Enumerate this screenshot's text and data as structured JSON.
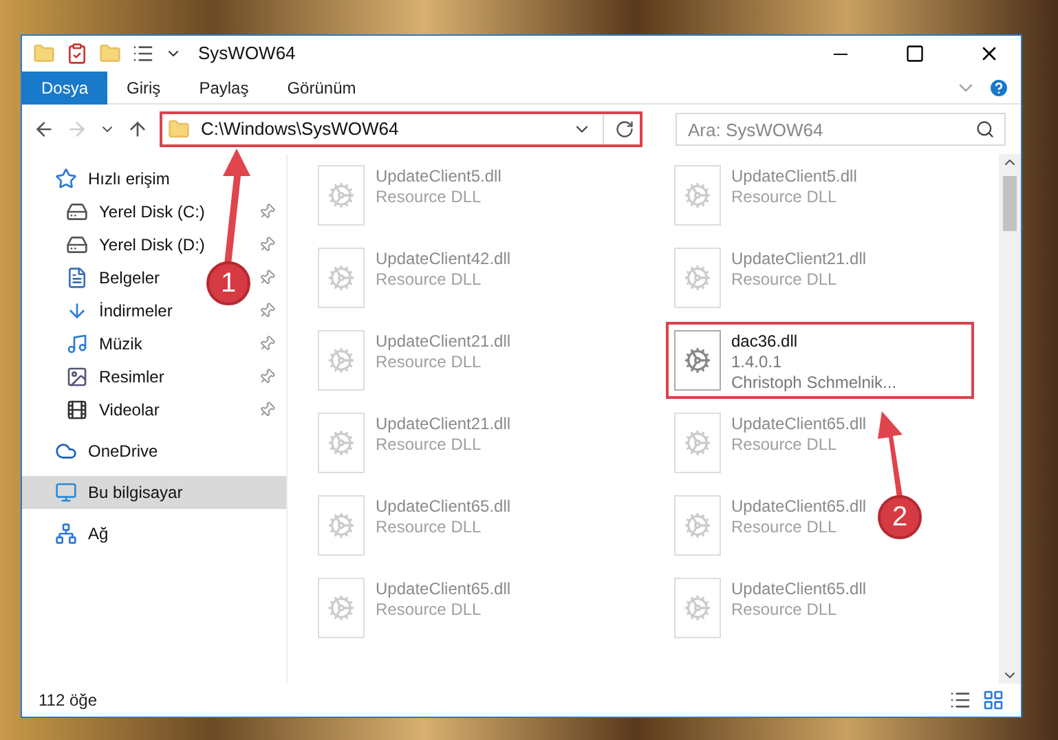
{
  "window": {
    "title": "SysWOW64"
  },
  "ribbon_tabs": [
    {
      "label": "Dosya",
      "selected": true
    },
    {
      "label": "Giriş",
      "selected": false
    },
    {
      "label": "Paylaş",
      "selected": false
    },
    {
      "label": "Görünüm",
      "selected": false
    }
  ],
  "address_bar": {
    "path": "C:\\Windows\\SysWOW64",
    "highlighted": true
  },
  "search": {
    "placeholder": "Ara: SysWOW64"
  },
  "sidebar": {
    "items": [
      {
        "label": "Hızlı erişim",
        "kind": "star",
        "selected": false,
        "children": [
          {
            "label": "Yerel Disk (C:)",
            "kind": "drive",
            "pinned": true
          },
          {
            "label": "Yerel Disk (D:)",
            "kind": "drive",
            "pinned": true
          },
          {
            "label": "Belgeler",
            "kind": "document",
            "pinned": true
          },
          {
            "label": "İndirmeler",
            "kind": "download",
            "pinned": true
          },
          {
            "label": "Müzik",
            "kind": "music",
            "pinned": true
          },
          {
            "label": "Resimler",
            "kind": "image",
            "pinned": true
          },
          {
            "label": "Videolar",
            "kind": "film",
            "pinned": true
          }
        ]
      },
      {
        "label": "OneDrive",
        "kind": "cloud",
        "selected": false
      },
      {
        "label": "Bu bilgisayar",
        "kind": "computer",
        "selected": true
      },
      {
        "label": "Ağ",
        "kind": "network",
        "selected": false
      }
    ]
  },
  "files": [
    {
      "name": "UpdateClient5.dll",
      "details": [
        "Resource DLL"
      ],
      "faded": true,
      "highlighted": false
    },
    {
      "name": "UpdateClient5.dll",
      "details": [
        "Resource DLL"
      ],
      "faded": true,
      "highlighted": false
    },
    {
      "name": "UpdateClient42.dll",
      "details": [
        "Resource DLL"
      ],
      "faded": true,
      "highlighted": false
    },
    {
      "name": "UpdateClient21.dll",
      "details": [
        "Resource DLL"
      ],
      "faded": true,
      "highlighted": false
    },
    {
      "name": "UpdateClient21.dll",
      "details": [
        "Resource DLL"
      ],
      "faded": true,
      "highlighted": false
    },
    {
      "name": "dac36.dll",
      "details": [
        "1.4.0.1",
        "Christoph Schmelnik..."
      ],
      "faded": false,
      "highlighted": true
    },
    {
      "name": "UpdateClient21.dll",
      "details": [
        "Resource DLL"
      ],
      "faded": true,
      "highlighted": false
    },
    {
      "name": "UpdateClient65.dll",
      "details": [
        "Resource DLL"
      ],
      "faded": true,
      "highlighted": false
    },
    {
      "name": "UpdateClient65.dll",
      "details": [
        "Resource DLL"
      ],
      "faded": true,
      "highlighted": false
    },
    {
      "name": "UpdateClient65.dll",
      "details": [
        "Resource DLL"
      ],
      "faded": true,
      "highlighted": false
    },
    {
      "name": "UpdateClient65.dll",
      "details": [
        "Resource DLL"
      ],
      "faded": true,
      "highlighted": false
    },
    {
      "name": "UpdateClient65.dll",
      "details": [
        "Resource DLL"
      ],
      "faded": true,
      "highlighted": false
    }
  ],
  "status_bar": {
    "count": "112 öğe"
  },
  "annotations": [
    {
      "number": "1"
    },
    {
      "number": "2"
    }
  ]
}
